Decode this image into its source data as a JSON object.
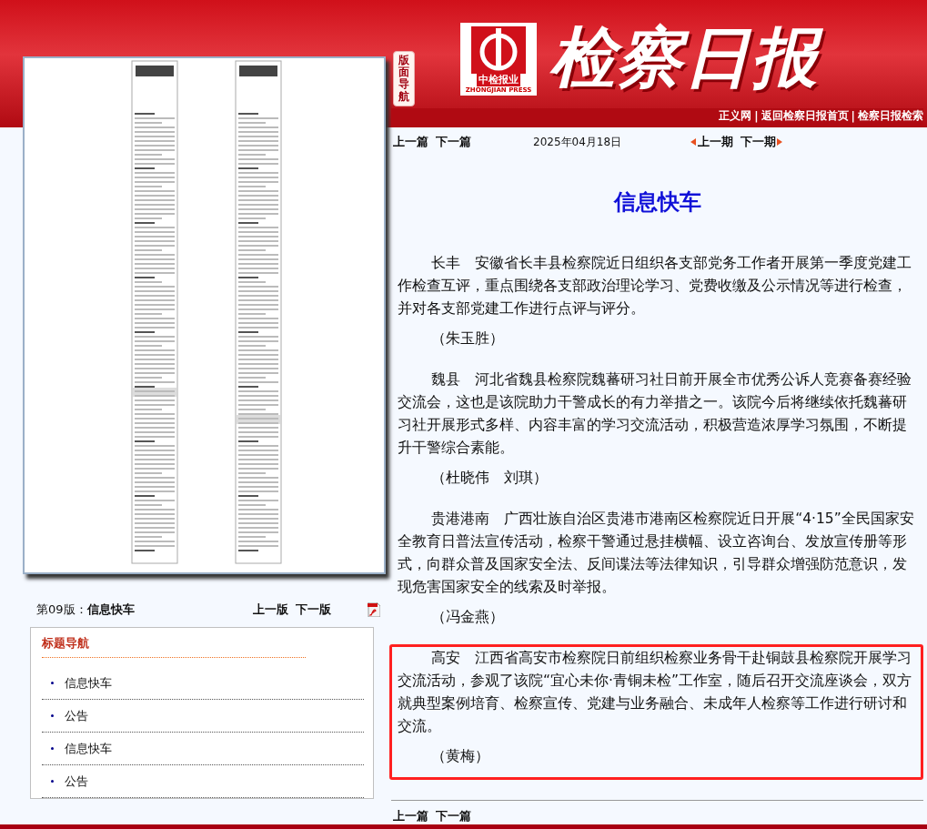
{
  "header": {
    "logo_badge": "中检报业",
    "logo_caption": "ZHONGJIAN PRESS",
    "masthead": "检察日报",
    "links": [
      "正义网",
      "返回检察日报首页",
      "检察日报检索"
    ],
    "link_separator": "|"
  },
  "section_nav_label": "版面导航",
  "article_nav": {
    "prev": "上一篇",
    "next": "下一篇",
    "date": "2025年04月18日",
    "prev_issue": "上一期",
    "next_issue": "下一期"
  },
  "article": {
    "title": "信息快车",
    "items": [
      {
        "text": "长丰　安徽省长丰县检察院近日组织各支部党务工作者开展第一季度党建工作检查互评，重点围绕各支部政治理论学习、党费收缴及公示情况等进行检查，并对各支部党建工作进行点评与评分。",
        "byline": "（朱玉胜）",
        "highlighted": false
      },
      {
        "text": "魏县　河北省魏县检察院魏蕃研习社日前开展全市优秀公诉人竞赛备赛经验交流会，这也是该院助力干警成长的有力举措之一。该院今后将继续依托魏蕃研习社开展形式多样、内容丰富的学习交流活动，积极营造浓厚学习氛围，不断提升干警综合素能。",
        "byline": "（杜晓伟　刘琪）",
        "highlighted": false
      },
      {
        "text": "贵港港南　广西壮族自治区贵港市港南区检察院近日开展“4·15”全民国家安全教育日普法宣传活动，检察干警通过悬挂横幅、设立咨询台、发放宣传册等形式，向群众普及国家安全法、反间谍法等法律知识，引导群众增强防范意识，发现危害国家安全的线索及时举报。",
        "byline": "（冯金燕）",
        "highlighted": false
      },
      {
        "text": "高安　江西省高安市检察院日前组织检察业务骨干赴铜鼓县检察院开展学习交流活动，参观了该院“宜心未你·青铜未检”工作室，随后召开交流座谈会，双方就典型案例培育、检察宣传、党建与业务融合、未成年人检察等工作进行研讨和交流。",
        "byline": "（黄梅）",
        "highlighted": true
      }
    ]
  },
  "bottom_nav": {
    "prev": "上一篇",
    "next": "下一篇"
  },
  "page_bar": {
    "page_label": "第09版：**信息快车**",
    "prev_page": "上一版",
    "next_page": "下一版"
  },
  "title_nav": {
    "heading": "标题导航",
    "items": [
      "信息快车",
      "公告",
      "信息快车",
      "公告"
    ]
  }
}
